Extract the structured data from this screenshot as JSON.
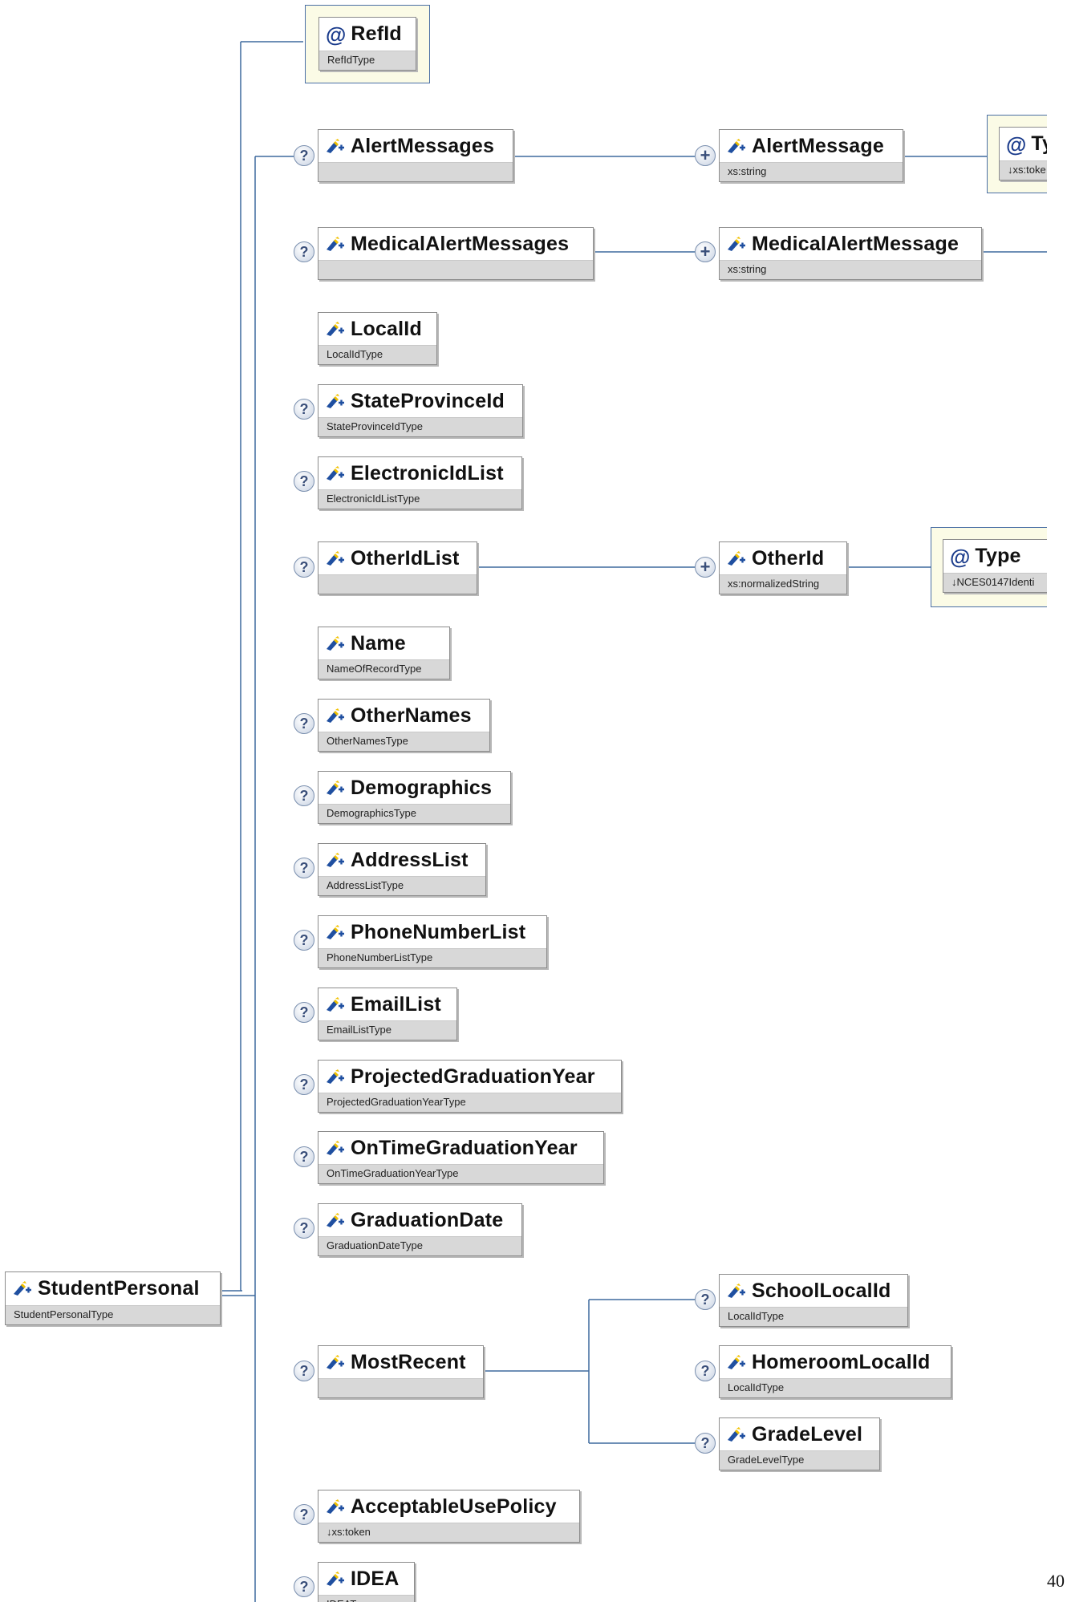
{
  "root": {
    "name": "StudentPersonal",
    "type": "StudentPersonalType"
  },
  "attributes": {
    "refid": {
      "name": "RefId",
      "type": "RefIdType"
    },
    "alert_type": {
      "name": "Ty",
      "type": "↓xs:toke"
    },
    "otherid_type": {
      "name": "Type",
      "type": "↓NCES0147Identi"
    }
  },
  "elements": {
    "alert_messages": {
      "name": "AlertMessages",
      "type": ""
    },
    "alert_message": {
      "name": "AlertMessage",
      "type": "xs:string"
    },
    "medical_alert_messages": {
      "name": "MedicalAlertMessages",
      "type": ""
    },
    "medical_alert_message": {
      "name": "MedicalAlertMessage",
      "type": "xs:string"
    },
    "local_id": {
      "name": "LocalId",
      "type": "LocalIdType"
    },
    "state_province_id": {
      "name": "StateProvinceId",
      "type": "StateProvinceIdType"
    },
    "electronic_id_list": {
      "name": "ElectronicIdList",
      "type": "ElectronicIdListType"
    },
    "other_id_list": {
      "name": "OtherIdList",
      "type": ""
    },
    "other_id": {
      "name": "OtherId",
      "type": "xs:normalizedString"
    },
    "name": {
      "name": "Name",
      "type": "NameOfRecordType"
    },
    "other_names": {
      "name": "OtherNames",
      "type": "OtherNamesType"
    },
    "demographics": {
      "name": "Demographics",
      "type": "DemographicsType"
    },
    "address_list": {
      "name": "AddressList",
      "type": "AddressListType"
    },
    "phone_number_list": {
      "name": "PhoneNumberList",
      "type": "PhoneNumberListType"
    },
    "email_list": {
      "name": "EmailList",
      "type": "EmailListType"
    },
    "projected_graduation_year": {
      "name": "ProjectedGraduationYear",
      "type": "ProjectedGraduationYearType"
    },
    "on_time_graduation_year": {
      "name": "OnTimeGraduationYear",
      "type": "OnTimeGraduationYearType"
    },
    "graduation_date": {
      "name": "GraduationDate",
      "type": "GraduationDateType"
    },
    "most_recent": {
      "name": "MostRecent",
      "type": ""
    },
    "school_local_id": {
      "name": "SchoolLocalId",
      "type": "LocalIdType"
    },
    "homeroom_local_id": {
      "name": "HomeroomLocalId",
      "type": "LocalIdType"
    },
    "grade_level": {
      "name": "GradeLevel",
      "type": "GradeLevelType"
    },
    "acceptable_use_policy": {
      "name": "AcceptableUsePolicy",
      "type": "↓xs:token"
    },
    "idea": {
      "name": "IDEA",
      "type": "IDEAType"
    }
  },
  "page_number": "40",
  "colors": {
    "connector": "#3f6a9e",
    "type_bar": "#d8d8d8",
    "attr_frame_bg": "#fbfbe6",
    "attr_frame_border": "#4a6fa5"
  }
}
